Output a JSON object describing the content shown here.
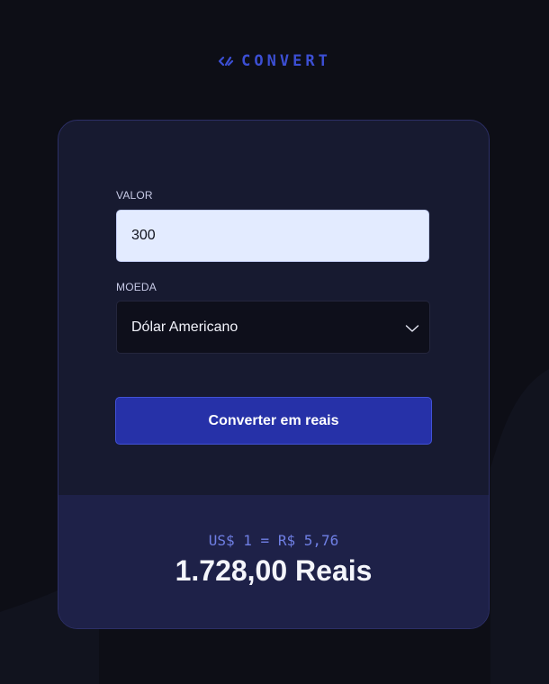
{
  "app": {
    "logo_text": "CONVERT",
    "logo_icon": "convert-arrows-icon",
    "accent_color": "#3c4fd4"
  },
  "form": {
    "amount_label": "VALOR",
    "amount_value": "300",
    "currency_label": "MOEDA",
    "currency_selected": "Dólar Americano",
    "currency_icon": "chevron-down-icon",
    "submit_label": "Converter em reais"
  },
  "result": {
    "rate": "US$ 1 = R$ 5,76",
    "total": "1.728,00 Reais"
  }
}
